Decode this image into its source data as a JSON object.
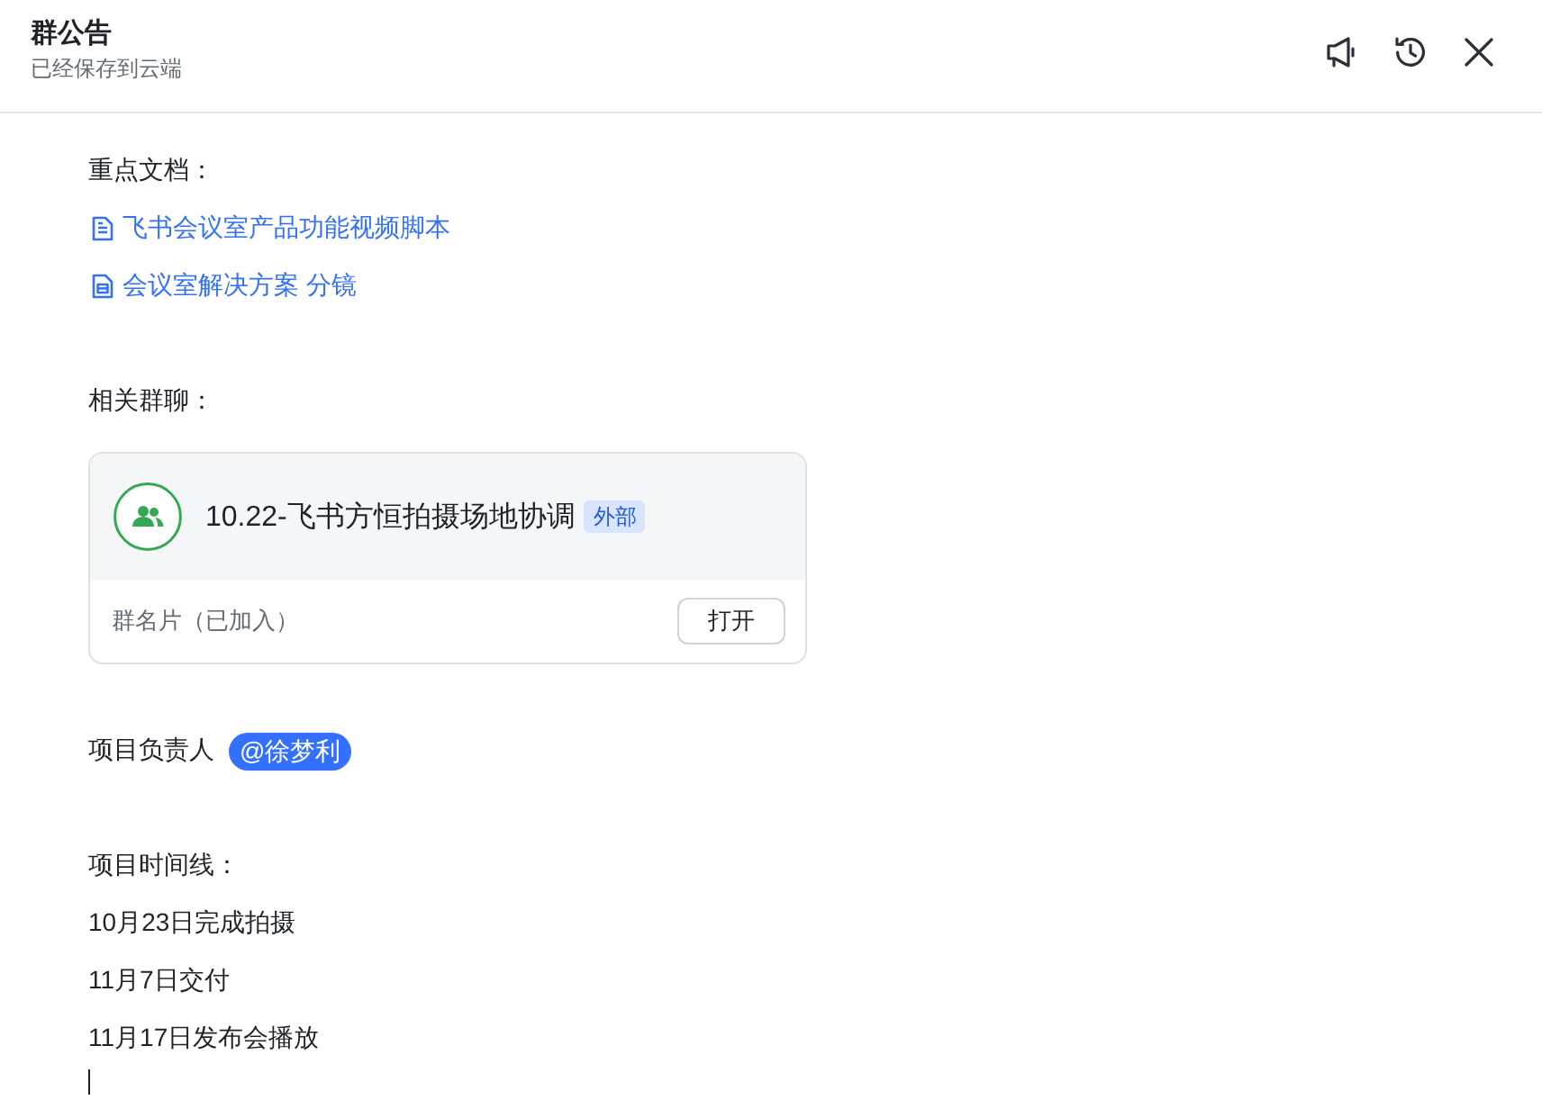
{
  "header": {
    "title": "群公告",
    "subtitle": "已经保存到云端"
  },
  "sections": [
    {
      "heading": "重点文档：",
      "items": [
        {
          "kind": "doc",
          "text": "飞书会议室产品功能视频脚本"
        },
        {
          "kind": "sheet",
          "text": "会议室解决方案 分镜"
        }
      ]
    },
    {
      "heading": "相关群聊：",
      "items": [
        {
          "kind": "group_card",
          "name": "10.22-飞书方恒拍摄场地协调",
          "badge": "外部",
          "caption": "群名片（已加入）",
          "button": "打开"
        }
      ]
    },
    {
      "items": [
        {
          "kind": "mention",
          "text": "项目负责人",
          "mention": "@徐梦利"
        }
      ]
    },
    {
      "heading": "项目时间线：",
      "items": [
        {
          "kind": "text",
          "text": "10月23日完成拍摄"
        },
        {
          "kind": "text",
          "text": "11月7日交付"
        },
        {
          "kind": "text",
          "text": "11月17日发布会播放"
        }
      ]
    }
  ]
}
